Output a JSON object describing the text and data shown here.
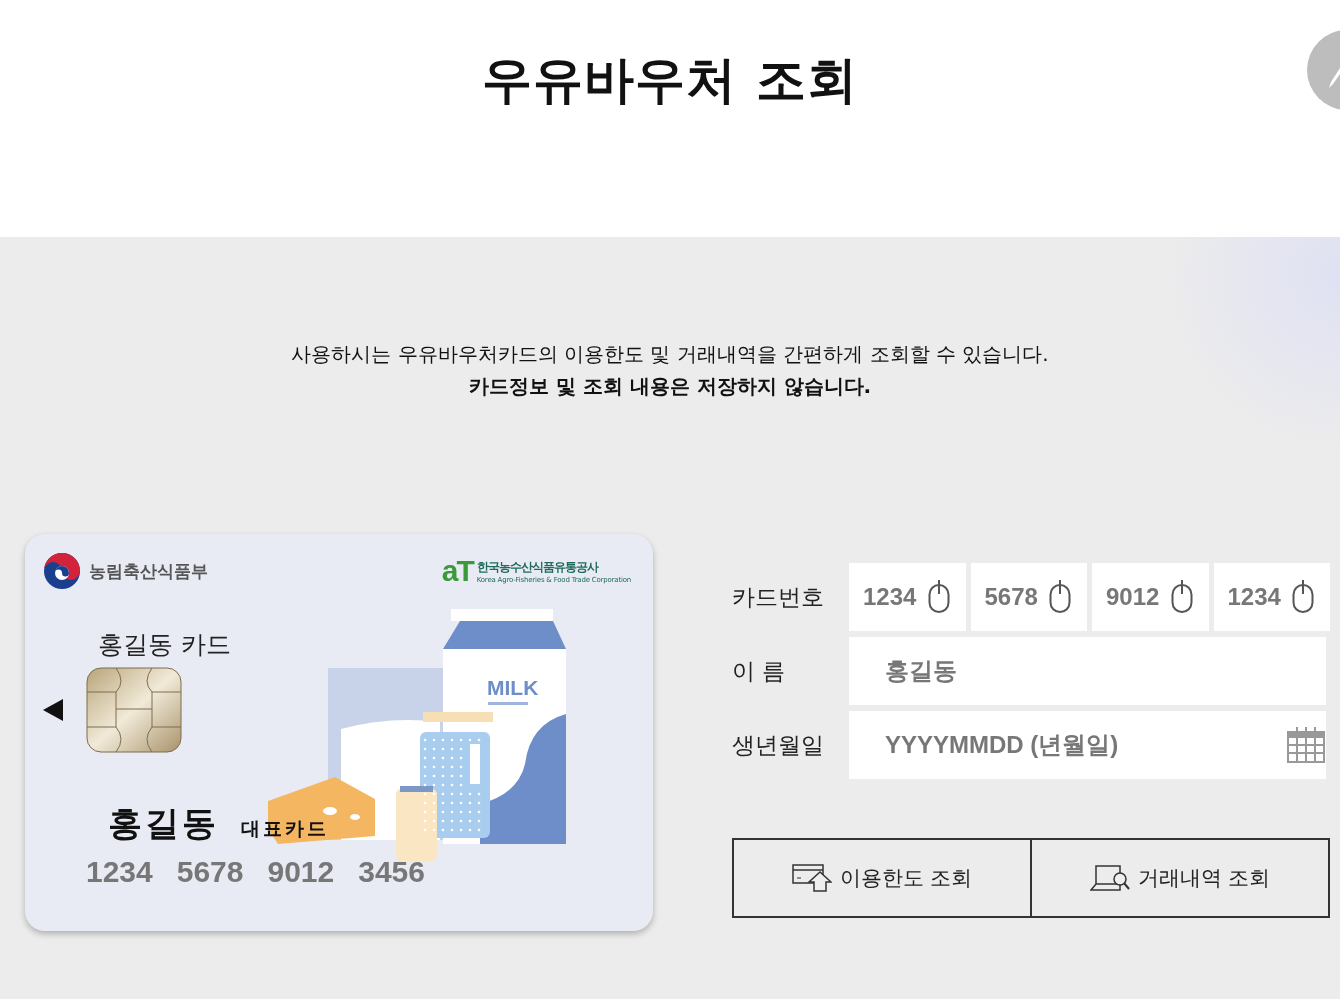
{
  "header": {
    "title": "우유바우처 조회"
  },
  "intro": {
    "line": "사용하시는 우유바우처카드의 이용한도 및 거래내역을 간편하게 조회할 수 있습니다.",
    "notice": "카드정보 및 조회 내용은 저장하지 않습니다."
  },
  "card": {
    "issuer": "농림축산식품부",
    "partner_mark": "aT",
    "partner_name": "한국농수산식품유통공사",
    "partner_name_en": "Korea Agro-Fisheries & Food Trade Corporation",
    "card_title": "홍길동 카드",
    "carton_label": "MILK",
    "holder": "홍길동",
    "badge": "대표카드",
    "number_groups": [
      "1234",
      "5678",
      "9012",
      "3456"
    ]
  },
  "form": {
    "fields": [
      {
        "kind": "card_number",
        "label": "카드번호",
        "groups": [
          {
            "placeholder": "1234"
          },
          {
            "placeholder": "5678"
          },
          {
            "placeholder": "9012"
          },
          {
            "placeholder": "1234"
          }
        ]
      },
      {
        "kind": "text",
        "label": "이 름",
        "placeholder": "홍길동"
      },
      {
        "kind": "date",
        "label": "생년월일",
        "placeholder": "YYYYMMDD (년월일)"
      }
    ],
    "buttons": [
      {
        "kind": "limit",
        "label": "이용한도 조회"
      },
      {
        "kind": "history",
        "label": "거래내역 조회"
      }
    ]
  }
}
